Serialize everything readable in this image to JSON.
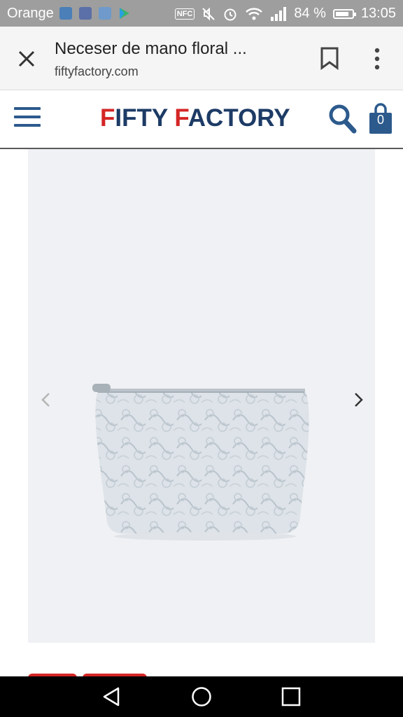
{
  "status_bar": {
    "carrier": "Orange",
    "nfc_label": "NFC",
    "battery_percent": "84 %",
    "battery_level": 0.84,
    "time": "13:05"
  },
  "tab_bar": {
    "title": "Neceser de mano floral ...",
    "url": "fiftyfactory.com",
    "icons": [
      "close-icon",
      "bookmark-icon",
      "more-vert-icon"
    ]
  },
  "site_header": {
    "logo_part1_initial": "F",
    "logo_part1_rest": "IFTY ",
    "logo_part2_initial": "F",
    "logo_part2_rest": "ACTORY",
    "cart_count": "0",
    "icons": [
      "menu-icon",
      "search-icon",
      "shopping-bag-icon"
    ],
    "colors": {
      "brand_blue": "#1d3b66",
      "brand_red": "#d42525",
      "icon_blue": "#2c5a8c"
    }
  },
  "product_gallery": {
    "image": "floral-pouch-image",
    "icons": [
      "chevron-left-icon",
      "chevron-right-icon"
    ]
  },
  "nav_bar": {
    "icons": [
      "back-triangle-icon",
      "home-circle-icon",
      "recents-square-icon"
    ]
  }
}
